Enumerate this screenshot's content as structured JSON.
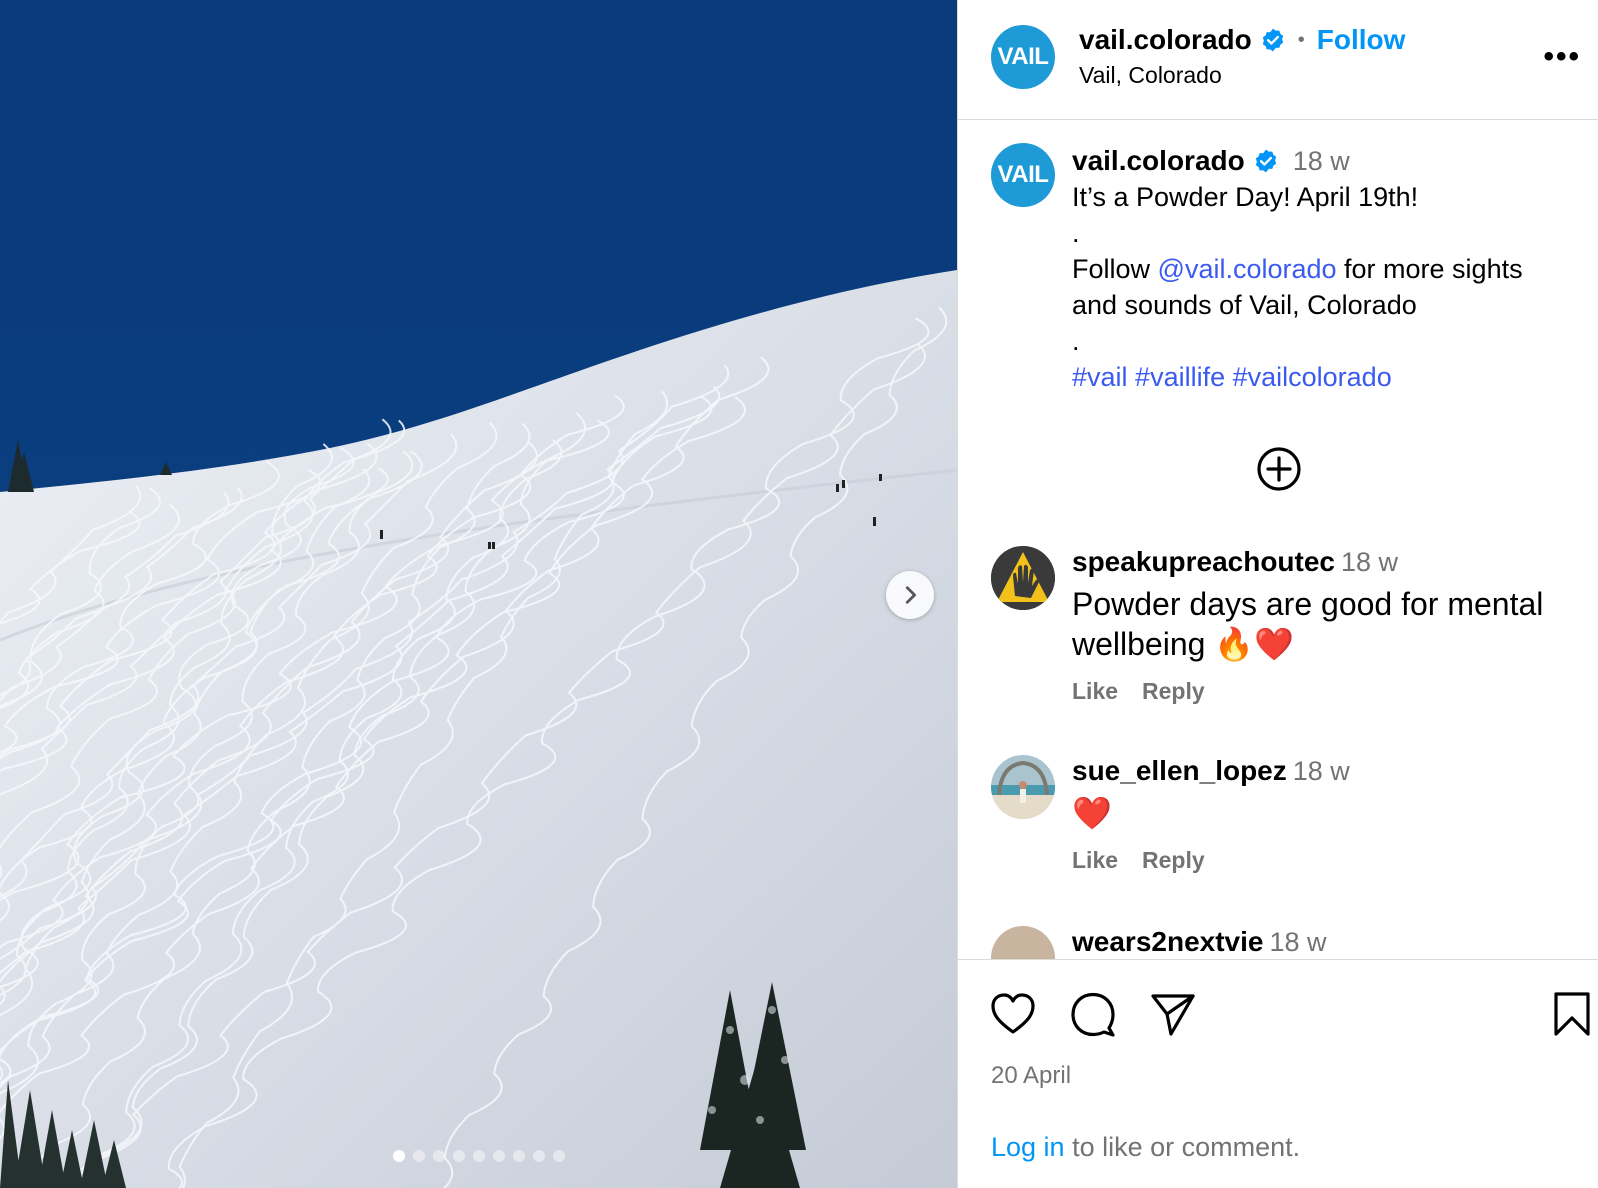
{
  "post": {
    "username": "vail.colorado",
    "follow_label": "Follow",
    "separator": "•",
    "location": "Vail, Colorado",
    "more_label": "•••",
    "avatar_text": "VAIL"
  },
  "caption": {
    "username": "vail.colorado",
    "time": "18 w",
    "line1": "It’s a Powder Day! April 19th!",
    "dot": ".",
    "follow_prefix": "Follow ",
    "mention": "@vail.colorado",
    "follow_suffix": " for more sights and sounds of Vail, Colorado",
    "hashtags": [
      "#vail",
      "#vaillife",
      "#vailcolorado"
    ]
  },
  "comments": [
    {
      "username": "speakupreachoutec",
      "time": "18 w",
      "text": "Powder days are good for mental wellbeing 🔥❤️",
      "like": "Like",
      "reply": "Reply"
    },
    {
      "username": "sue_ellen_lopez",
      "time": "18 w",
      "text": "❤️",
      "like": "Like",
      "reply": "Reply"
    },
    {
      "username": "wears2nextvie",
      "time": "18 w"
    }
  ],
  "footer": {
    "date": "20 April",
    "login_link": "Log in",
    "login_rest": " to like or comment."
  },
  "carousel": {
    "slides": 9,
    "active_index": 0
  },
  "colors": {
    "link": "#0095f6",
    "mention": "#3b5af0",
    "verified": "#0095f6",
    "vail_blue": "#1e9ad6",
    "sky": "#0a3c7e"
  },
  "icons": [
    "verified-badge-icon",
    "more-options-icon",
    "chevron-right-icon",
    "add-comment-plus-icon",
    "heart-icon",
    "comment-icon",
    "share-icon",
    "bookmark-icon"
  ]
}
